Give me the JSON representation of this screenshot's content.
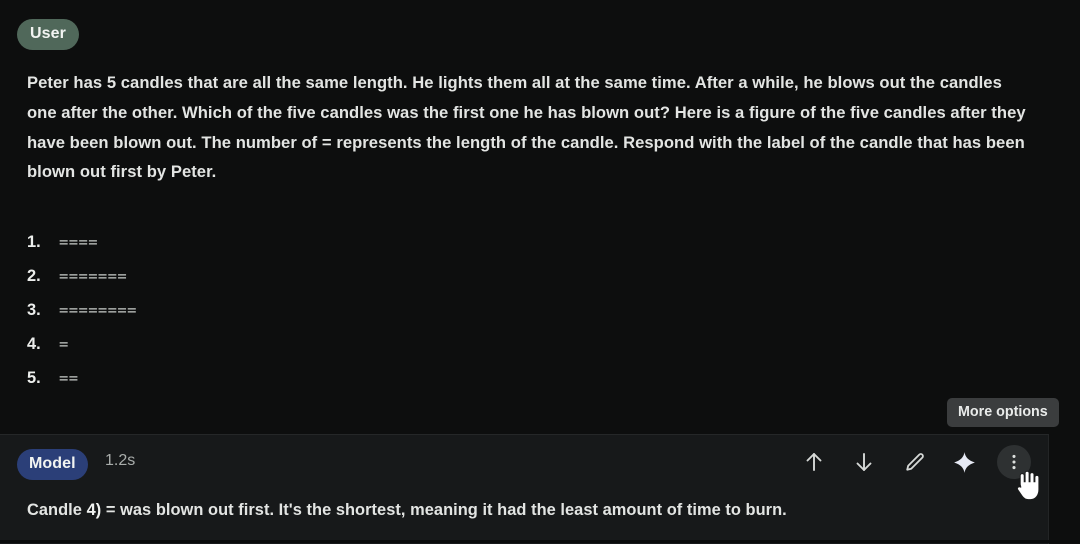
{
  "page": {
    "background_color": "#0d0e0e"
  },
  "user_turn": {
    "role_label": "User",
    "badge_color": "#50685a",
    "prompt": "Peter has 5 candles that are all the same length. He lights them all at the same time. After a while, he blows out the candles one after the other. Which of the five candles was the first one he has blown out? Here is a figure of the five candles after they have been blown out. The number of = represents the length of the candle. Respond with the label of the candle that has been blown out first by Peter.",
    "candles": [
      {
        "number": "1.",
        "bars": "===="
      },
      {
        "number": "2.",
        "bars": "======="
      },
      {
        "number": "3.",
        "bars": "========"
      },
      {
        "number": "4.",
        "bars": "="
      },
      {
        "number": "5.",
        "bars": "=="
      }
    ]
  },
  "tooltip": {
    "label": "More options"
  },
  "model_turn": {
    "role_label": "Model",
    "badge_color": "#2b3f78",
    "latency": "1.2s",
    "answer_prefix": "Candle ",
    "answer_emphasis": "4)",
    "answer_suffix": " = was blown out first. It's the shortest, meaning it had the least amount of time to burn.",
    "actions": [
      {
        "name": "arrow-up-icon",
        "title": "Previous"
      },
      {
        "name": "arrow-down-icon",
        "title": "Next"
      },
      {
        "name": "pencil-icon",
        "title": "Edit"
      },
      {
        "name": "sparkle-icon",
        "title": "Rerun"
      },
      {
        "name": "more-vertical-icon",
        "title": "More options"
      }
    ]
  }
}
